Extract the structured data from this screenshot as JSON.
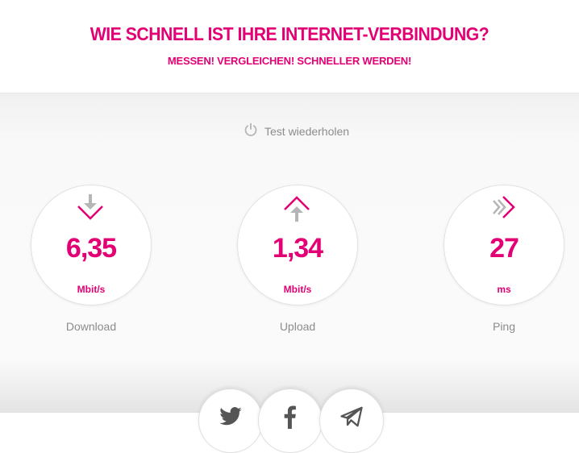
{
  "header": {
    "title": "WIE SCHNELL IST IHRE INTERNET-VERBINDUNG?",
    "subtitle": "MESSEN! VERGLEICHEN! SCHNELLER WERDEN!"
  },
  "retest": {
    "label": "Test wiederholen",
    "icon": "power-icon"
  },
  "metrics": [
    {
      "value": "6,35",
      "unit": "Mbit/s",
      "label": "Download",
      "icon": "download-icon"
    },
    {
      "value": "1,34",
      "unit": "Mbit/s",
      "label": "Upload",
      "icon": "upload-icon"
    },
    {
      "value": "27",
      "unit": "ms",
      "label": "Ping",
      "icon": "ping-icon"
    }
  ],
  "share": [
    {
      "icon": "twitter-icon"
    },
    {
      "icon": "facebook-icon"
    },
    {
      "icon": "telegram-icon"
    }
  ],
  "colors": {
    "accent": "#e20074",
    "muted_text": "#8c8c8c",
    "icon_grey": "#b5b5b5"
  }
}
